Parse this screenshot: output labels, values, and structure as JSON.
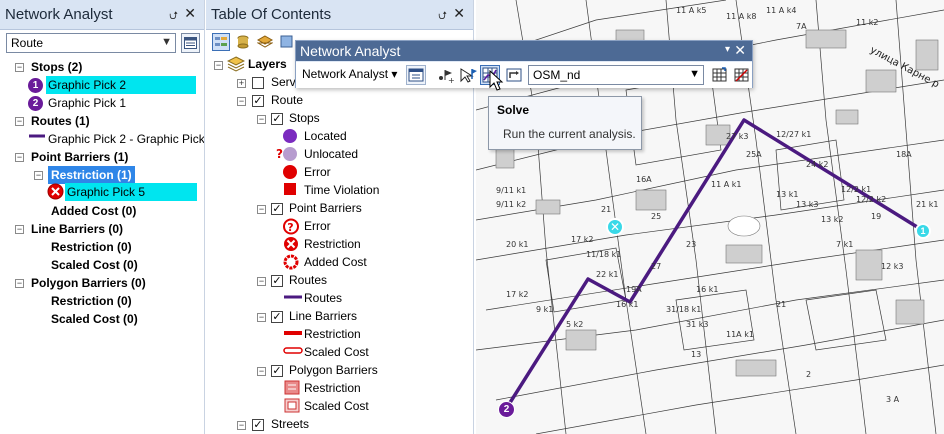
{
  "na_window": {
    "title": "Network Analyst",
    "pin_glyph": "⮍",
    "close_glyph": "✕",
    "analysis_select": "Route",
    "groups": [
      {
        "label": "Stops (2)",
        "items": [
          "Graphic Pick 2",
          "Graphic Pick 1"
        ]
      },
      {
        "label": "Routes (1)",
        "items": [
          "Graphic Pick 2 - Graphic Pick"
        ]
      },
      {
        "label": "Point Barriers (1)",
        "sub": [
          {
            "label": "Restriction (1)",
            "items": [
              "Graphic Pick 5"
            ]
          },
          {
            "label": "Added Cost (0)"
          }
        ]
      },
      {
        "label": "Line Barriers (0)",
        "sub": [
          {
            "label": "Restriction (0)"
          },
          {
            "label": "Scaled Cost (0)"
          }
        ]
      },
      {
        "label": "Polygon Barriers (0)",
        "sub": [
          {
            "label": "Restriction (0)"
          },
          {
            "label": "Scaled Cost (0)"
          }
        ]
      }
    ],
    "stop_numbers": [
      "1",
      "2"
    ]
  },
  "toc": {
    "title": "Table Of Contents",
    "layers_label": "Layers",
    "service_label": "Servi",
    "route_label": "Route",
    "stops_label": "Stops",
    "stops_items": [
      "Located",
      "Unlocated",
      "Error",
      "Time Violation"
    ],
    "point_barriers_label": "Point Barriers",
    "point_barriers_items": [
      "Error",
      "Restriction",
      "Added Cost"
    ],
    "routes_label": "Routes",
    "routes_items": [
      "Routes"
    ],
    "line_barriers_label": "Line Barriers",
    "line_barriers_items": [
      "Restriction",
      "Scaled Cost"
    ],
    "polygon_barriers_label": "Polygon Barriers",
    "polygon_barriers_items": [
      "Restriction",
      "Scaled Cost"
    ],
    "streets_label": "Streets"
  },
  "floating_toolbar": {
    "title": "Network Analyst",
    "menu_label": "Network Analyst ▾",
    "network_dataset": "OSM_nd"
  },
  "tooltip": {
    "title": "Solve",
    "description": "Run the current analysis."
  },
  "map": {
    "street_label": "улица Карне р",
    "stop_badges": [
      "1",
      "2"
    ],
    "barrier_glyph": "✕",
    "labels": [
      "11 A k5",
      "11 A k8",
      "11 A k4",
      "7A",
      "11 k2",
      "9/11 k1",
      "9/11 k2",
      "11/18 k1",
      "17 k2",
      "21",
      "20 k1",
      "25",
      "16A",
      "11 A k1",
      "13 k1",
      "13 k3",
      "12/2 k1",
      "12/2 k2",
      "13 k2",
      "19",
      "27",
      "23",
      "22 k1",
      "19A",
      "16 k1",
      "16 k1",
      "31/18 k1",
      "31 k3",
      "11A k1",
      "25A",
      "27 k3",
      "12/27 k1",
      "24 k2",
      "13",
      "21",
      "17 k2",
      "9 k1",
      "5 k2",
      "7 k1",
      "18A",
      "21 k1",
      "12 k3",
      "2",
      "3 A"
    ]
  },
  "colors": {
    "route_purple": "#4b1a80",
    "stop_purple": "#6a1b9a",
    "highlight_cyan": "#00e5ef",
    "selection_blue": "#2f86e8",
    "error_red": "#e00000",
    "barrier_cyan": "#39d9e8",
    "title_blue": "#d9e4f3",
    "floater_head": "#4d6a95"
  }
}
